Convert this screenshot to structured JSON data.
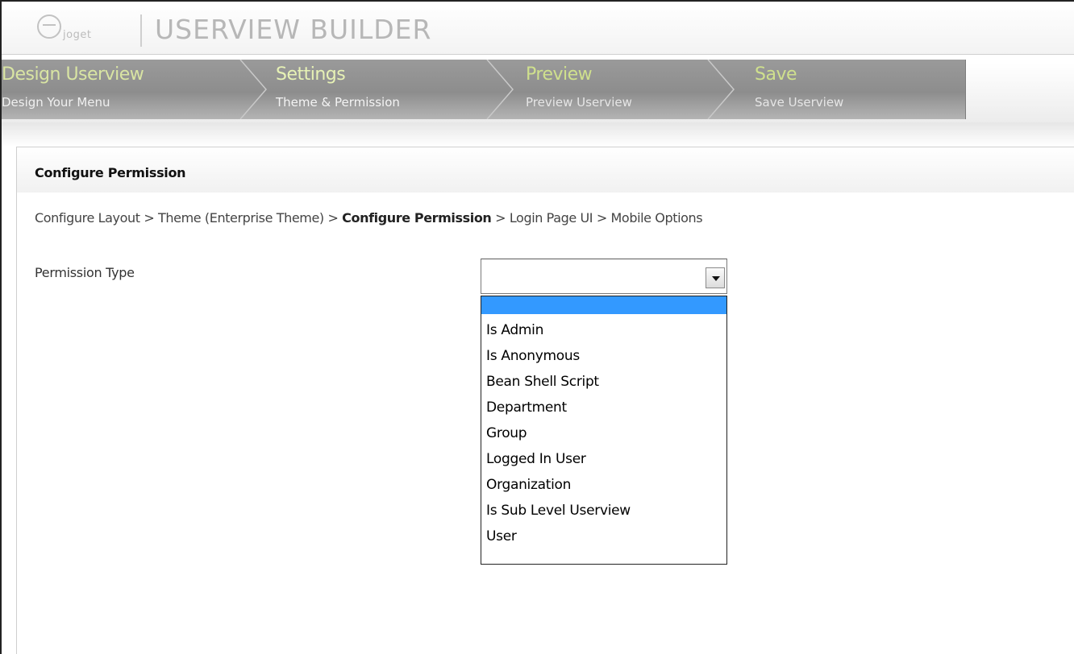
{
  "header": {
    "logo_text": "joget",
    "title": "USERVIEW BUILDER"
  },
  "wizard": {
    "steps": [
      {
        "title": "Design Userview",
        "subtitle": "Design Your Menu"
      },
      {
        "title": "Settings",
        "subtitle": "Theme & Permission"
      },
      {
        "title": "Preview",
        "subtitle": "Preview Userview"
      },
      {
        "title": "Save",
        "subtitle": "Save Userview"
      }
    ]
  },
  "panel": {
    "title": "Configure Permission",
    "breadcrumb": [
      {
        "label": "Configure Layout"
      },
      {
        "label": "Theme (Enterprise Theme)"
      },
      {
        "label": "Configure Permission"
      },
      {
        "label": "Login Page UI"
      },
      {
        "label": "Mobile Options"
      }
    ],
    "separator": ">"
  },
  "form": {
    "permission_type_label": "Permission Type",
    "permission_type_value": "",
    "options": [
      "",
      "Is Admin",
      "Is Anonymous",
      "Bean Shell Script",
      "Department",
      "Group",
      "Logged In User",
      "Organization",
      "Is Sub Level Userview",
      "User"
    ]
  },
  "colors": {
    "selection": "#3399ff",
    "step_title": "#d9e5a3",
    "step_bar": "#8d8d8d"
  }
}
